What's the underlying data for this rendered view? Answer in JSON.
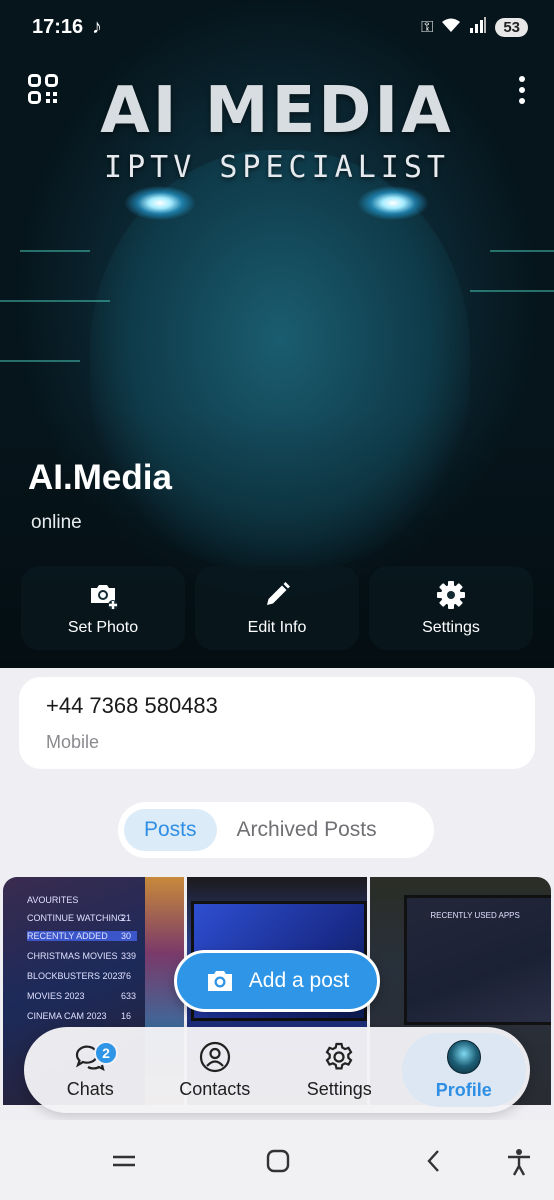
{
  "status_bar": {
    "time": "17:16",
    "battery": "53"
  },
  "cover": {
    "brand": "AI MEDIA",
    "brand_sub": "IPTV SPECIALIST"
  },
  "profile": {
    "name": "AI.Media",
    "status": "online"
  },
  "actions": [
    {
      "label": "Set Photo",
      "icon": "camera-add-icon"
    },
    {
      "label": "Edit Info",
      "icon": "pencil-icon"
    },
    {
      "label": "Settings",
      "icon": "gear-icon"
    }
  ],
  "phone": {
    "number": "+44 7368 580483",
    "label": "Mobile"
  },
  "tabs": [
    {
      "label": "Posts",
      "active": true
    },
    {
      "label": "Archived Posts",
      "active": false
    }
  ],
  "posts": {
    "post1_rows": [
      "AVOURITES",
      "CONTINUE WATCHING",
      "RECENTLY ADDED",
      "CHRISTMAS MOVIES",
      "BLOCKBUSTERS 2023",
      "MOVIES 2023",
      "CINEMA CAM 2023"
    ],
    "post1_counts": [
      "21",
      "30",
      "339",
      "76",
      "633",
      "16"
    ],
    "post3_heading": "RECENTLY USED APPS"
  },
  "add_post": {
    "label": "Add a post"
  },
  "bottom_nav": [
    {
      "label": "Chats",
      "icon": "chat-bubbles-icon",
      "badge": "2"
    },
    {
      "label": "Contacts",
      "icon": "person-icon"
    },
    {
      "label": "Settings",
      "icon": "gear-icon"
    },
    {
      "label": "Profile",
      "icon": "avatar",
      "active": true
    }
  ],
  "colors": {
    "accent": "#2f95e6",
    "active_tab_bg": "#dcebf8"
  }
}
